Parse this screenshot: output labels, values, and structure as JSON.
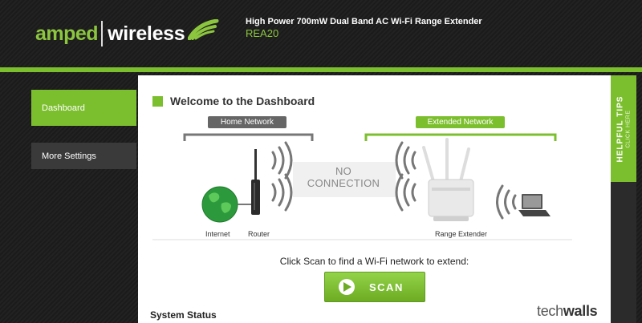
{
  "header": {
    "logo_primary": "amped",
    "logo_secondary": "wireless",
    "product_title": "High Power 700mW Dual Band AC Wi-Fi Range Extender",
    "product_model": "REA20"
  },
  "sidebar": {
    "items": [
      {
        "label": "Dashboard",
        "active": true
      },
      {
        "label": "More Settings",
        "active": false
      }
    ]
  },
  "main": {
    "heading": "Welcome to the Dashboard",
    "home_network_label": "Home Network",
    "extended_network_label": "Extended Network",
    "no_connection_line1": "NO",
    "no_connection_line2": "CONNECTION",
    "captions": {
      "internet": "Internet",
      "router": "Router",
      "range_extender": "Range Extender"
    },
    "scan_prompt": "Click Scan to find a Wi-Fi network to extend:",
    "scan_button": "SCAN",
    "system_status": "System Status"
  },
  "tips": {
    "title": "HELPFUL TIPS",
    "subtitle": "CLICK HERE"
  },
  "watermark": {
    "part1": "tech",
    "part2": "walls"
  },
  "colors": {
    "accent": "#7cbf2e",
    "dark": "#1e1e1e",
    "panel": "#ffffff"
  },
  "icons": [
    "wifi-waves-icon",
    "globe-icon",
    "router-icon",
    "range-extender-icon",
    "laptop-icon",
    "play-icon"
  ]
}
